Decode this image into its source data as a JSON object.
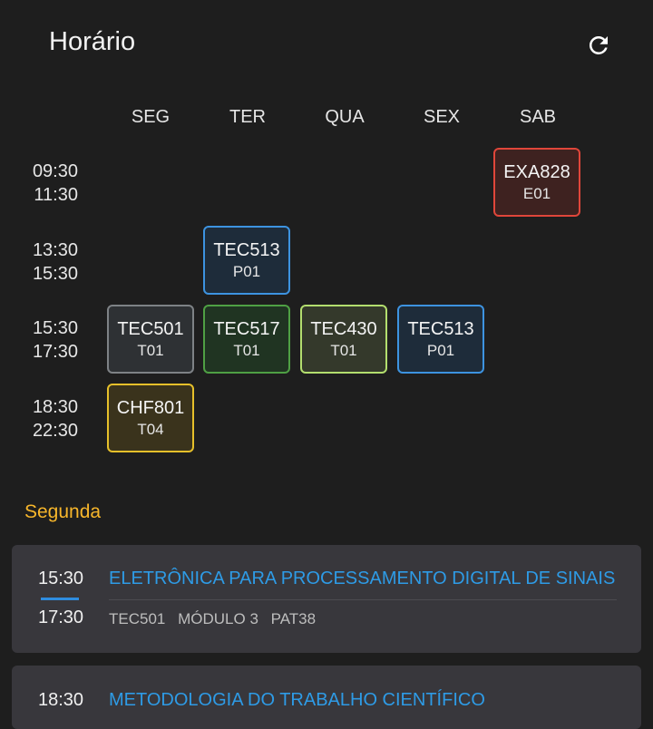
{
  "header": {
    "title": "Horário"
  },
  "week": {
    "days": [
      "SEG",
      "TER",
      "QUA",
      "SEX",
      "SAB"
    ]
  },
  "times": [
    {
      "start": "09:30",
      "end": "11:30"
    },
    {
      "start": "13:30",
      "end": "15:30"
    },
    {
      "start": "15:30",
      "end": "17:30"
    },
    {
      "start": "18:30",
      "end": "22:30"
    }
  ],
  "classes": [
    {
      "code": "EXA828",
      "turma": "E01",
      "day": "SAB",
      "slot": 0,
      "border": "#e0463a",
      "fill": "#3e2220"
    },
    {
      "code": "TEC513",
      "turma": "P01",
      "day": "TER",
      "slot": 1,
      "border": "#3d93e0",
      "fill": "#1e2c3a"
    },
    {
      "code": "TEC501",
      "turma": "T01",
      "day": "SEG",
      "slot": 2,
      "border": "#7e8286",
      "fill": "#2e3134"
    },
    {
      "code": "TEC517",
      "turma": "T01",
      "day": "TER",
      "slot": 2,
      "border": "#4fa044",
      "fill": "#203422"
    },
    {
      "code": "TEC430",
      "turma": "T01",
      "day": "QUA",
      "slot": 2,
      "border": "#b3de6e",
      "fill": "#34392b"
    },
    {
      "code": "TEC513",
      "turma": "P01",
      "day": "SEX",
      "slot": 2,
      "border": "#3d93e0",
      "fill": "#1e2c3a"
    },
    {
      "code": "CHF801",
      "turma": "T04",
      "day": "SEG",
      "slot": 3,
      "border": "#e6c02a",
      "fill": "#3a331c"
    }
  ],
  "section": {
    "title": "Segunda"
  },
  "agenda": [
    {
      "start": "15:30",
      "end": "17:30",
      "name": "ELETRÔNICA PARA PROCESSAMENTO DIGITAL DE SINAIS",
      "code": "TEC501",
      "module": "MÓDULO 3",
      "room": "PAT38"
    },
    {
      "start": "18:30",
      "name": "METODOLOGIA DO TRABALHO CIENTÍFICO"
    }
  ],
  "icons": {
    "refresh": "refresh-icon"
  },
  "colors": {
    "accent": "#2e9be6",
    "section": "#f7b62b",
    "background": "#1e1e1e",
    "card": "#38373c"
  }
}
